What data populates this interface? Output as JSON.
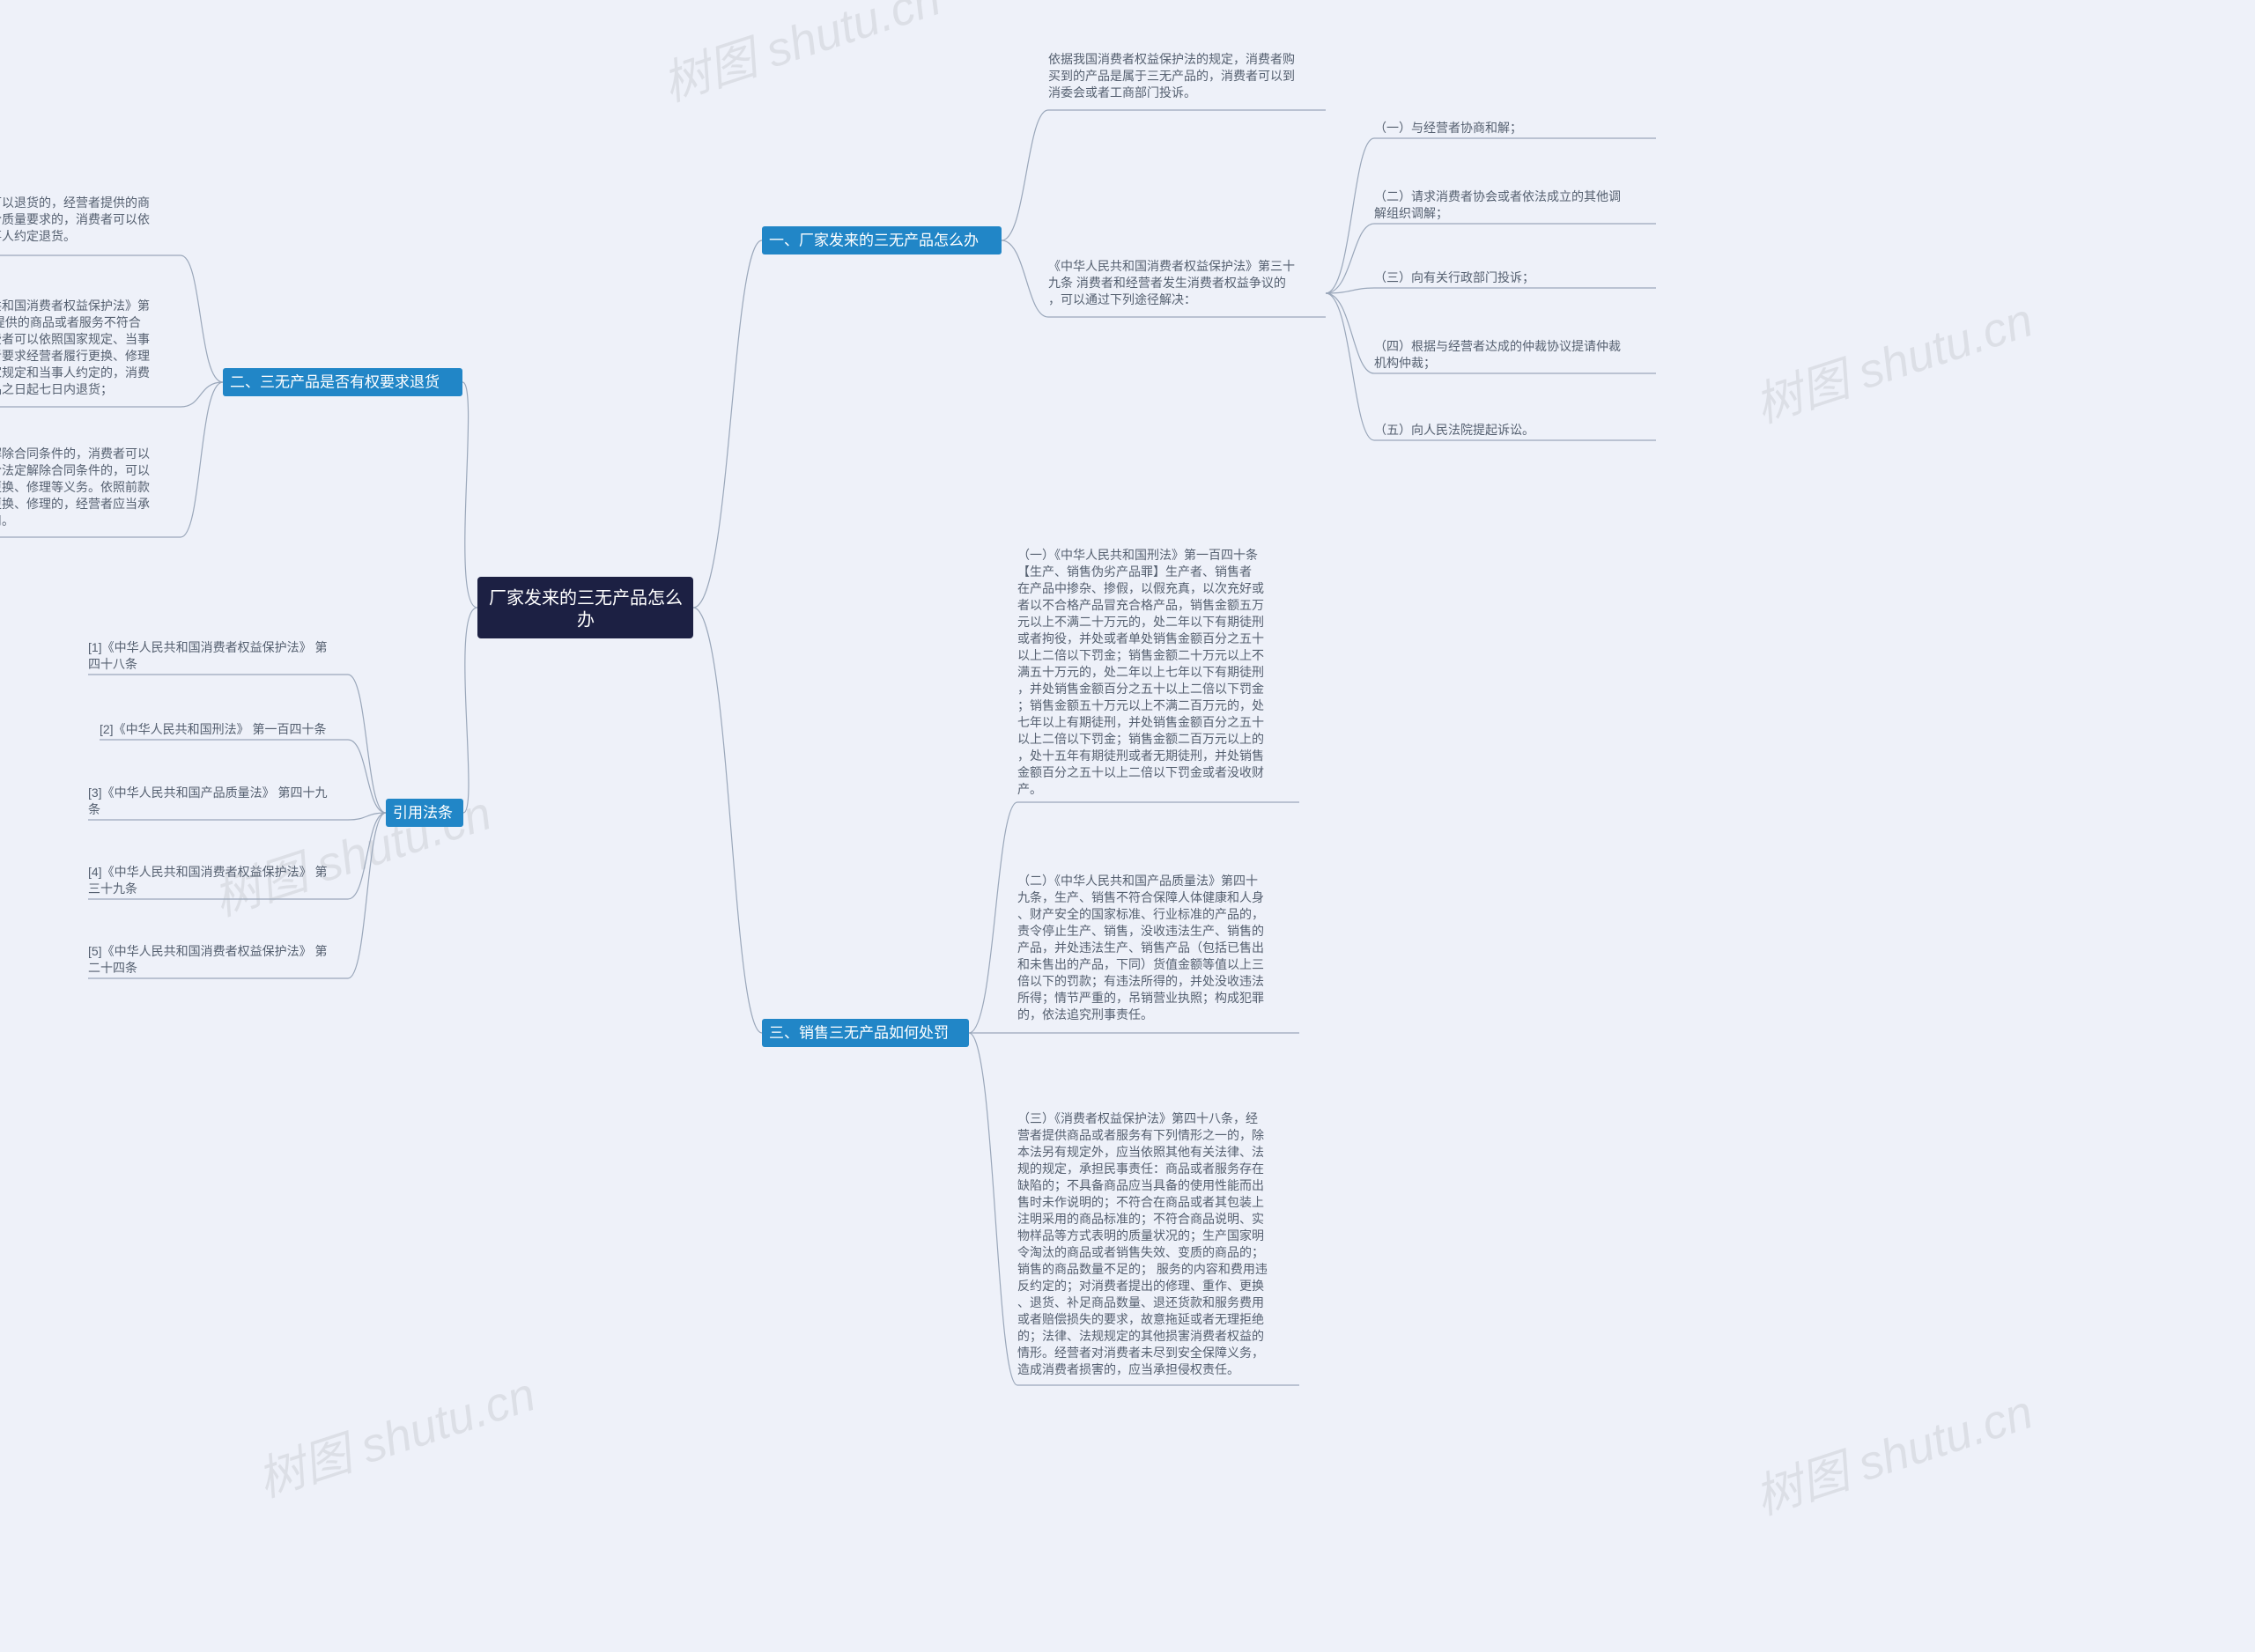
{
  "root": {
    "title_line1": "厂家发来的三无产品怎么",
    "title_line2": "办"
  },
  "branches": {
    "b1": {
      "label": "一、厂家发来的三无产品怎么办",
      "a": "依据我国消费者权益保护法的规定，消费者购\n买到的产品是属于三无产品的，消费者可以到\n消委会或者工商部门投诉。",
      "b": "《中华人民共和国消费者权益保护法》第三十\n九条 消费者和经营者发生消费者权益争议的\n，可以通过下列途径解决：",
      "b_children": {
        "c1": "（一）与经营者协商和解；",
        "c2": "（二）请求消费者协会或者依法成立的其他调\n解组织调解；",
        "c3": "（三）向有关行政部门投诉；",
        "c4": "（四）根据与经营者达成的仲裁协议提请仲裁\n机构仲裁；",
        "c5": "（五）向人民法院提起诉讼。"
      }
    },
    "b2": {
      "label": "二、三无产品是否有权要求退货",
      "a": "买了三无产品是可以退货的，经营者提供的商\n品或者服务不符合质量要求的，消费者可以依\n照国家规定、当事人约定退货。",
      "b": "根据《中华人民共和国消费者权益保护法》第\n二十四条 经营者提供的商品或者服务不符合\n质量要求的，消费者可以依照国家规定、当事\n人约定退货，或者要求经营者履行更换、修理\n等义务。没有国家规定和当事人约定的，消费\n者可以自收到商品之日起七日内退货；",
      "c": "七日后符合法定解除合同条件的，消费者可以\n及时退货，不符合法定解除合同条件的，可以\n要求经营者履行更换、修理等义务。依照前款\n规定进行退货、更换、修理的，经营者应当承\n担运输等必要费用。"
    },
    "b3": {
      "label": "三、销售三无产品如何处罚",
      "a": "（一）《中华人民共和国刑法》第一百四十条\n【生产、销售伪劣产品罪】生产者、销售者\n在产品中掺杂、掺假，以假充真，以次充好或\n者以不合格产品冒充合格产品，销售金额五万\n元以上不满二十万元的，处二年以下有期徒刑\n或者拘役，并处或者单处销售金额百分之五十\n以上二倍以下罚金；销售金额二十万元以上不\n满五十万元的，处二年以上七年以下有期徒刑\n，并处销售金额百分之五十以上二倍以下罚金\n；销售金额五十万元以上不满二百万元的，处\n七年以上有期徒刑，并处销售金额百分之五十\n以上二倍以下罚金；销售金额二百万元以上的\n，处十五年有期徒刑或者无期徒刑，并处销售\n金额百分之五十以上二倍以下罚金或者没收财\n产。",
      "b": "（二）《中华人民共和国产品质量法》第四十\n九条，生产、销售不符合保障人体健康和人身\n、财产安全的国家标准、行业标准的产品的，\n责令停止生产、销售，没收违法生产、销售的\n产品，并处违法生产、销售产品（包括已售出\n和未售出的产品，下同）货值金额等值以上三\n倍以下的罚款；有违法所得的，并处没收违法\n所得；情节严重的，吊销营业执照；构成犯罪\n的，依法追究刑事责任。",
      "c": "（三）《消费者权益保护法》第四十八条，经\n营者提供商品或者服务有下列情形之一的，除\n本法另有规定外，应当依照其他有关法律、法\n规的规定，承担民事责任：商品或者服务存在\n缺陷的；不具备商品应当具备的使用性能而出\n售时未作说明的；不符合在商品或者其包装上\n注明采用的商品标准的；不符合商品说明、实\n物样品等方式表明的质量状况的；生产国家明\n令淘汰的商品或者销售失效、变质的商品的；\n销售的商品数量不足的； 服务的内容和费用违\n反约定的；对消费者提出的修理、重作、更换\n、退货、补足商品数量、退还货款和服务费用\n或者赔偿损失的要求，故意拖延或者无理拒绝\n的；法律、法规规定的其他损害消费者权益的\n情形。经营者对消费者未尽到安全保障义务，\n造成消费者损害的，应当承担侵权责任。"
    },
    "b4": {
      "label": "引用法条",
      "refs": {
        "r1": "[1]《中华人民共和国消费者权益保护法》 第\n四十八条",
        "r2": "[2]《中华人民共和国刑法》 第一百四十条",
        "r3": "[3]《中华人民共和国产品质量法》 第四十九\n条",
        "r4": "[4]《中华人民共和国消费者权益保护法》 第\n三十九条",
        "r5": "[5]《中华人民共和国消费者权益保护法》 第\n二十四条"
      }
    }
  },
  "watermark": "树图 shutu.cn"
}
